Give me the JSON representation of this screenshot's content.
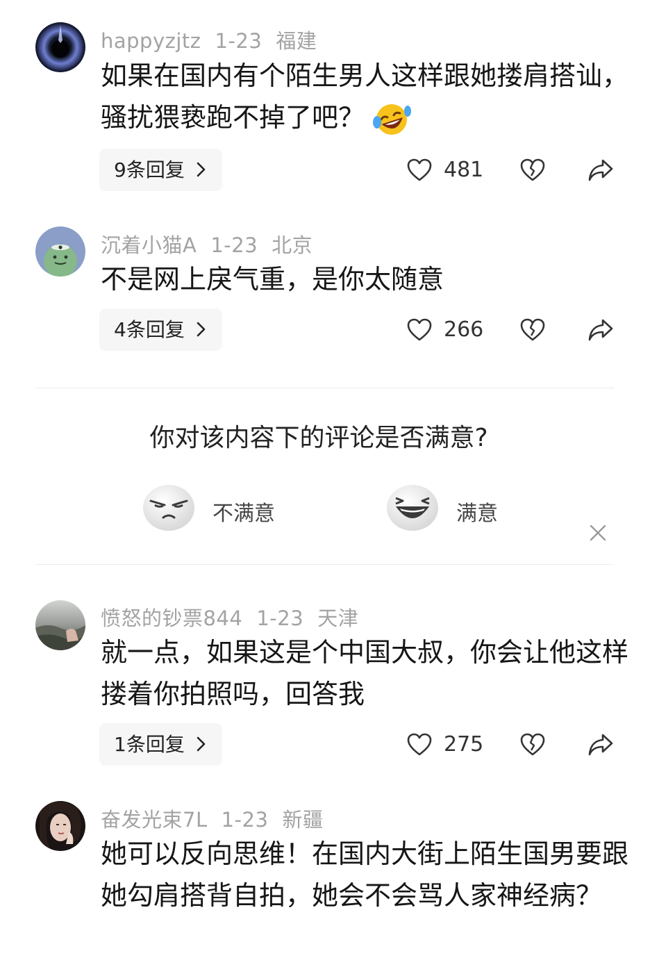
{
  "comments": [
    {
      "username": "happyzjtz",
      "date": "1-23",
      "location": "福建",
      "text": "如果在国内有个陌生男人这样跟她搂肩搭讪，骚扰猥亵跑不掉了吧？",
      "emoji": "laughing-crying-emoji",
      "replies_label": "9条回复",
      "likes": "481"
    },
    {
      "username": "沉着小猫A",
      "date": "1-23",
      "location": "北京",
      "text": "不是网上戾气重，是你太随意",
      "replies_label": "4条回复",
      "likes": "266"
    },
    {
      "username": "愤怒的钞票844",
      "date": "1-23",
      "location": "天津",
      "text": "就一点，如果这是个中国大叔，你会让他这样搂着你拍照吗，回答我",
      "replies_label": "1条回复",
      "likes": "275"
    },
    {
      "username": "奋发光束7L",
      "date": "1-23",
      "location": "新疆",
      "text": "她可以反向思维！在国内大街上陌生国男要跟她勾肩搭背自拍，她会不会骂人家神经病？"
    }
  ],
  "survey": {
    "question": "你对该内容下的评论是否满意?",
    "option_unsatisfied": "不满意",
    "option_satisfied": "满意"
  },
  "icons": {
    "like": "heart-outline-icon",
    "dislike": "broken-heart-icon",
    "share": "share-arrow-icon",
    "close": "close-icon",
    "chevron": "chevron-right-icon"
  }
}
